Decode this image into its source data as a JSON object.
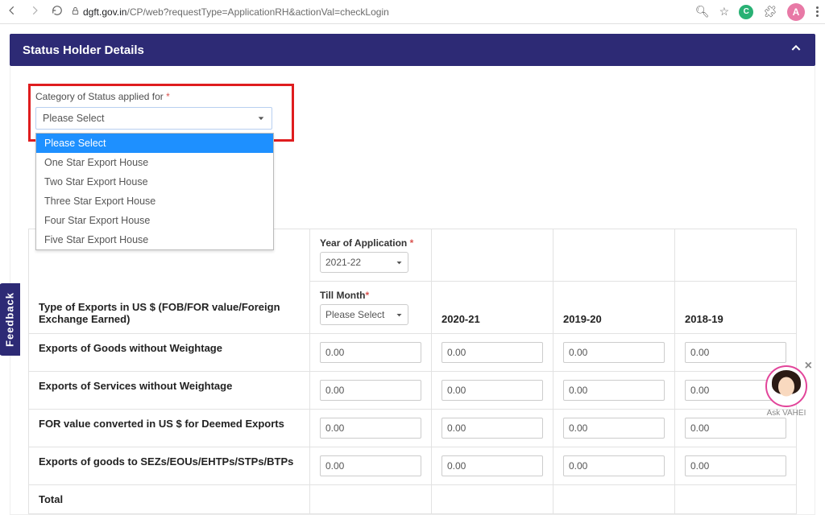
{
  "chrome": {
    "url_host": "dgft.gov.in",
    "url_path": "/CP/web?requestType=ApplicationRH&actionVal=checkLogin",
    "ext_letter": "C",
    "avatar_letter": "A"
  },
  "panel": {
    "title": "Status Holder Details"
  },
  "category": {
    "label": "Category of Status applied for ",
    "selected": "Please Select",
    "options": [
      "Please Select",
      "One Star Export House",
      "Two Star Export House",
      "Three Star Export House",
      "Four Star Export House",
      "Five Star Export House"
    ]
  },
  "table": {
    "type_header": "Type of Exports in US $ (FOB/FOR value/Foreign Exchange Earned)",
    "year_of_app_label": "Year of Application ",
    "year_of_app_value": "2021-22",
    "till_month_label": "Till Month",
    "till_month_value": "Please Select",
    "year_headers": [
      "2020-21",
      "2019-20",
      "2018-19"
    ],
    "rows": [
      {
        "label": "Exports of Goods without Weightage",
        "values": [
          "0.00",
          "0.00",
          "0.00",
          "0.00"
        ]
      },
      {
        "label": "Exports of Services without Weightage",
        "values": [
          "0.00",
          "0.00",
          "0.00",
          "0.00"
        ]
      },
      {
        "label": "FOR value converted in US $ for Deemed Exports",
        "values": [
          "0.00",
          "0.00",
          "0.00",
          "0.00"
        ]
      },
      {
        "label": "Exports of goods to SEZs/EOUs/EHTPs/STPs/BTPs",
        "values": [
          "0.00",
          "0.00",
          "0.00",
          "0.00"
        ]
      },
      {
        "label": "Total",
        "values": [
          "",
          "",
          "",
          ""
        ]
      }
    ]
  },
  "feedback": "Feedback",
  "vahei": {
    "label": "Ask VAHEI"
  }
}
